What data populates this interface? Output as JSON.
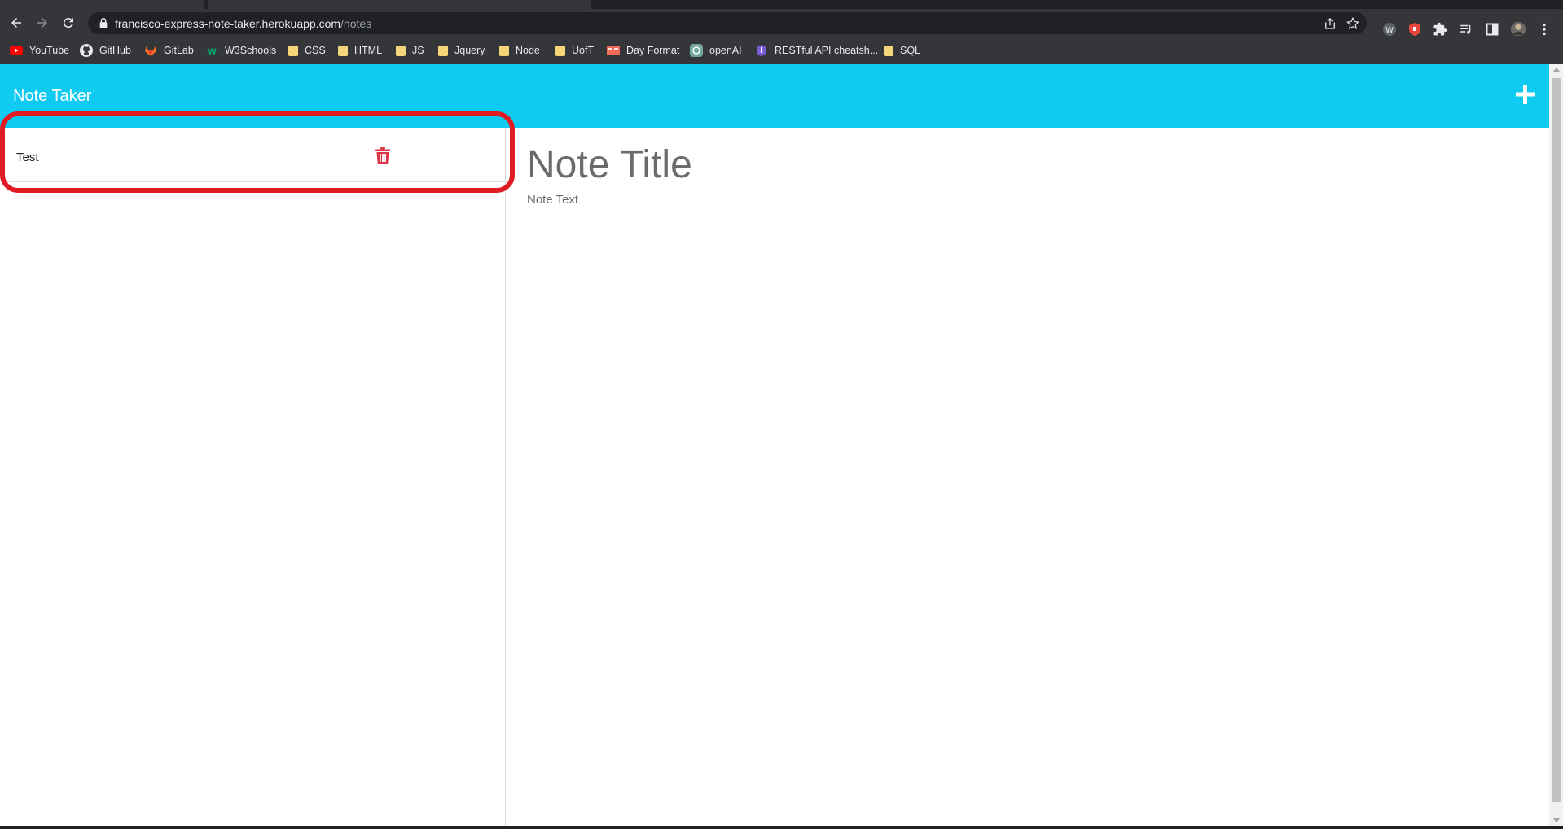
{
  "browser": {
    "url_host": "francisco-express-note-taker.herokuapp.com",
    "url_path": "/notes",
    "bookmarks": [
      {
        "label": "YouTube",
        "icon": "youtube-icon"
      },
      {
        "label": "GitHub",
        "icon": "github-icon"
      },
      {
        "label": "GitLab",
        "icon": "gitlab-icon"
      },
      {
        "label": "W3Schools",
        "icon": "w3schools-icon"
      },
      {
        "label": "CSS",
        "icon": "folder-icon"
      },
      {
        "label": "HTML",
        "icon": "folder-icon"
      },
      {
        "label": "JS",
        "icon": "folder-icon"
      },
      {
        "label": "Jquery",
        "icon": "folder-icon"
      },
      {
        "label": "Node",
        "icon": "folder-icon"
      },
      {
        "label": "UofT",
        "icon": "folder-icon"
      },
      {
        "label": "Day Format",
        "icon": "day-format-icon"
      },
      {
        "label": "openAI",
        "icon": "openai-icon"
      },
      {
        "label": "RESTful API cheatsh...",
        "icon": "restful-api-icon"
      },
      {
        "label": "SQL",
        "icon": "folder-icon"
      }
    ]
  },
  "app": {
    "brand": "Note Taker",
    "accent_color": "#0fcbf1",
    "delete_color": "#dc3545",
    "highlight_color": "#e01b24"
  },
  "notes": [
    {
      "title": "Test"
    }
  ],
  "editor": {
    "title_placeholder": "Note Title",
    "text_placeholder": "Note Text"
  }
}
